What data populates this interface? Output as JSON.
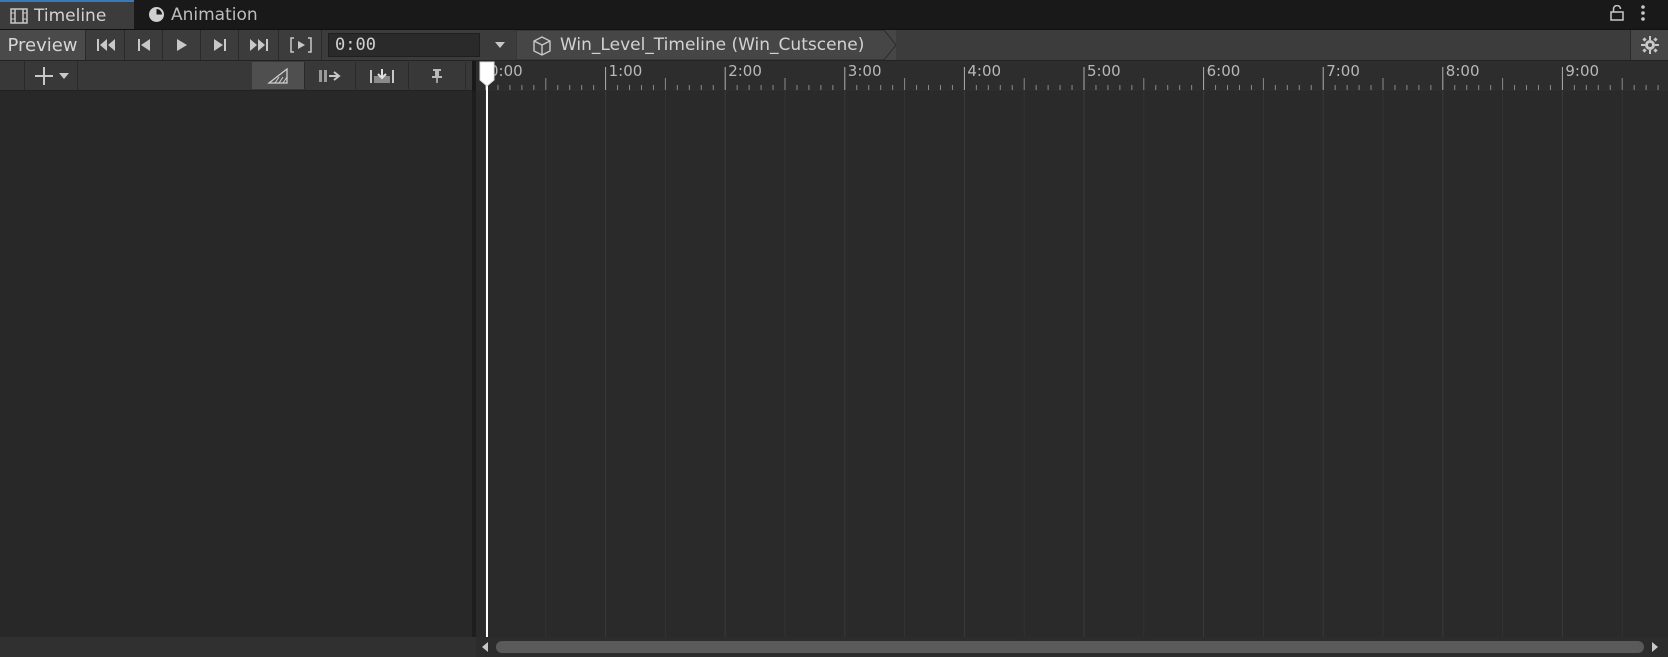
{
  "tabs": [
    {
      "label": "Timeline",
      "icon": "film-icon",
      "active": true
    },
    {
      "label": "Animation",
      "icon": "clock-icon",
      "active": false
    }
  ],
  "toolbar": {
    "preview_label": "Preview",
    "time_value": "0:00",
    "breadcrumb": "Win_Level_Timeline (Win_Cutscene)"
  },
  "ruler": {
    "labels": [
      "0:00",
      "1:00",
      "2:00",
      "3:00",
      "4:00",
      "5:00",
      "6:00",
      "7:00",
      "8:00",
      "9:00"
    ]
  },
  "colors": {
    "accent": "#3a79bb",
    "playhead": "#ffffff",
    "background": "#282828"
  }
}
